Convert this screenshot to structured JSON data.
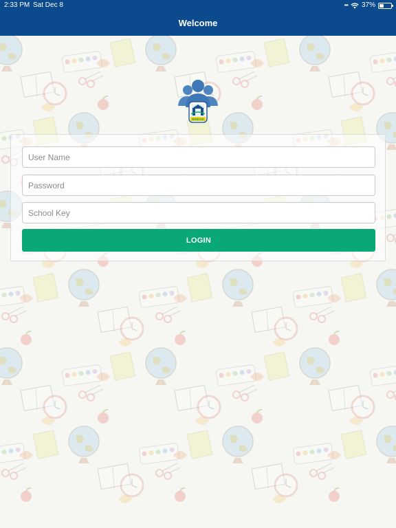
{
  "status_bar": {
    "time": "2:33 PM",
    "date": "Sat Dec 8",
    "battery": "37%",
    "battery_level": 0.37
  },
  "nav": {
    "title": "Welcome"
  },
  "logo": {
    "text": "BRIDGE"
  },
  "form": {
    "username": {
      "placeholder": "User Name",
      "value": ""
    },
    "password": {
      "placeholder": "Password",
      "value": ""
    },
    "school_key": {
      "placeholder": "School Key",
      "value": ""
    },
    "login_label": "LOGIN"
  },
  "colors": {
    "nav_bar": "#0b4a8c",
    "login_button": "#0aa877",
    "background": "#f6f7f2"
  }
}
